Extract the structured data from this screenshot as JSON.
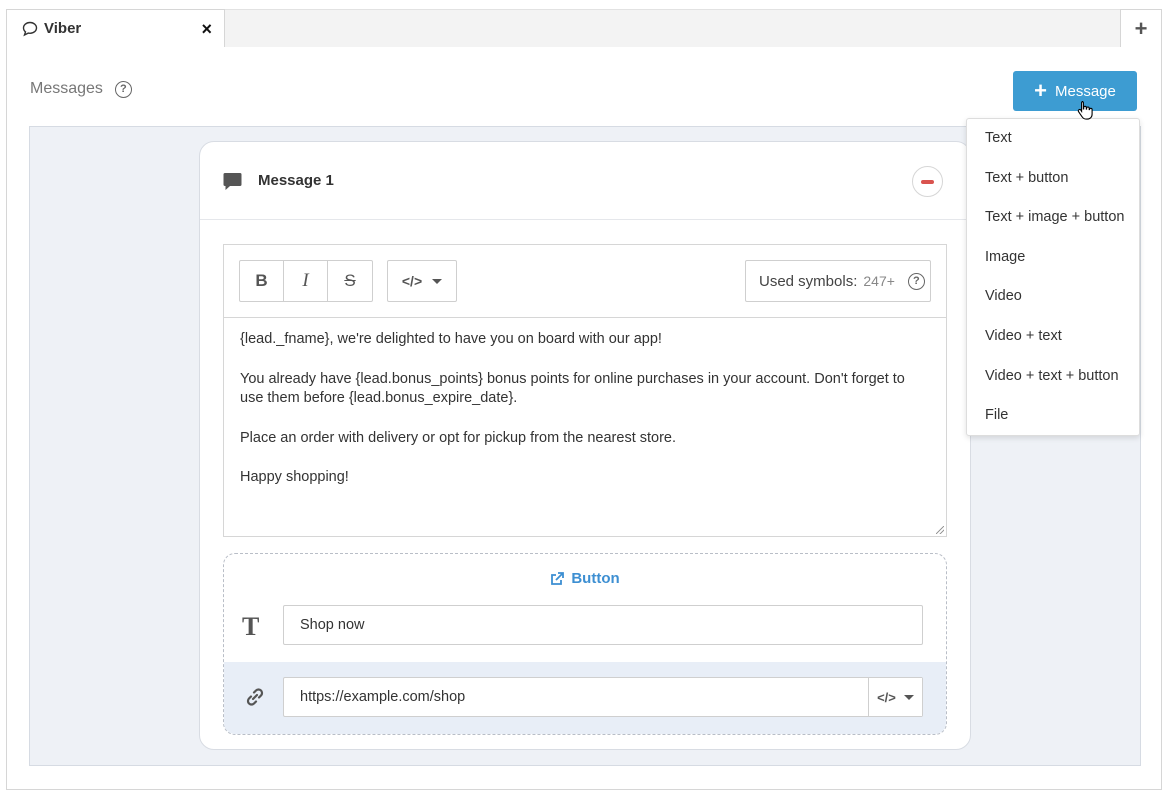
{
  "tab": {
    "title": "Viber",
    "close_icon": "×",
    "add_icon": "+"
  },
  "header": {
    "messages_label": "Messages",
    "help_icon": "?",
    "add_message_label": "Message",
    "add_icon": "+"
  },
  "card": {
    "title": "Message 1",
    "toolbar": {
      "bold": "B",
      "italic": "I",
      "strike": "S",
      "code": "</>",
      "symbols_label": "Used symbols:",
      "symbols_count": "247+",
      "help_icon": "?"
    },
    "body": [
      "{lead._fname}, we're delighted to have you on board with our app!",
      "You already have  {lead.bonus_points} bonus points for online purchases in your account. Don't forget to use them before  {lead.bonus_expire_date}.",
      "Place an order with delivery or opt for pickup from the nearest store.",
      "Happy shopping!"
    ],
    "button_section": {
      "heading": "Button",
      "text_value": "Shop now",
      "url_value": "https://example.com/shop",
      "code": "</>"
    }
  },
  "dropdown": {
    "items": [
      "Text",
      "Text + button",
      "Text + image + button",
      "Image",
      "Video",
      "Video + text",
      "Video + text + button",
      "File"
    ]
  },
  "colors": {
    "accent": "#3d9cd2",
    "link": "#3d8fd2",
    "danger": "#d9534f",
    "canvas": "#eef1f6"
  }
}
